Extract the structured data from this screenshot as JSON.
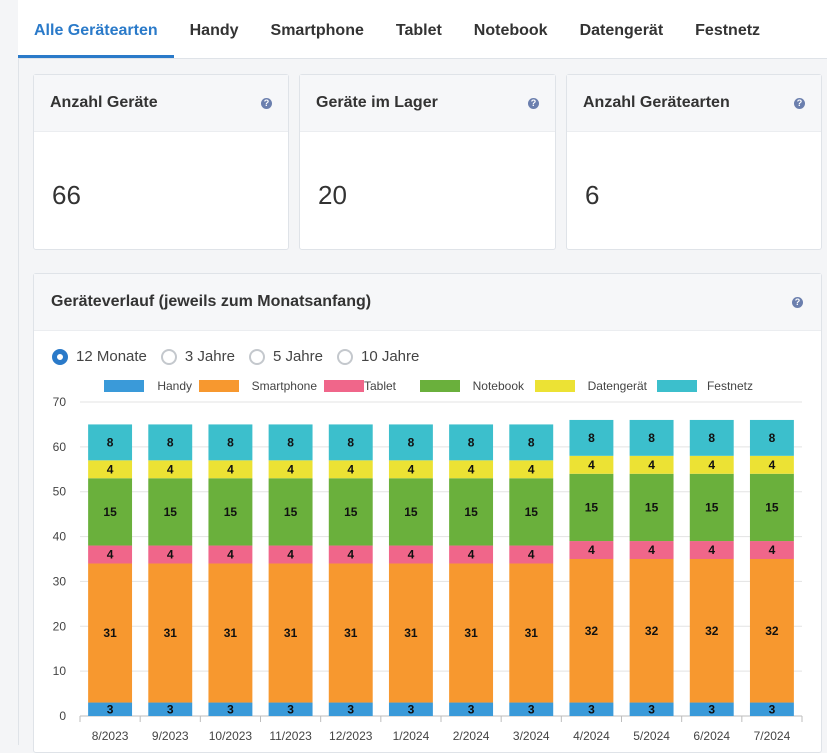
{
  "tabs": [
    "Alle Gerätearten",
    "Handy",
    "Smartphone",
    "Tablet",
    "Notebook",
    "Datengerät",
    "Festnetz"
  ],
  "cards": [
    {
      "title": "Anzahl Geräte",
      "value": "66"
    },
    {
      "title": "Geräte im Lager",
      "value": "20"
    },
    {
      "title": "Anzahl Gerätearten",
      "value": "6"
    }
  ],
  "help_glyph": "?",
  "panel_title": "Geräteverlauf (jeweils zum Monatsanfang)",
  "ranges": [
    "12 Monate",
    "3 Jahre",
    "5 Jahre",
    "10 Jahre"
  ],
  "selected_range": "12 Monate",
  "colors": {
    "accent": "#2a7ac9",
    "Handy": "#3a9ad9",
    "Smartphone": "#f7982f",
    "Tablet": "#f0668a",
    "Notebook": "#6ab03c",
    "Datengerät": "#ece234",
    "Festnetz": "#3cbfcc"
  },
  "chart_data": {
    "type": "bar",
    "stacked": true,
    "categories": [
      "8/2023",
      "9/2023",
      "10/2023",
      "11/2023",
      "12/2023",
      "1/2024",
      "2/2024",
      "3/2024",
      "4/2024",
      "5/2024",
      "6/2024",
      "7/2024"
    ],
    "series": [
      {
        "name": "Handy",
        "values": [
          3,
          3,
          3,
          3,
          3,
          3,
          3,
          3,
          3,
          3,
          3,
          3
        ]
      },
      {
        "name": "Smartphone",
        "values": [
          31,
          31,
          31,
          31,
          31,
          31,
          31,
          31,
          32,
          32,
          32,
          32
        ]
      },
      {
        "name": "Tablet",
        "values": [
          4,
          4,
          4,
          4,
          4,
          4,
          4,
          4,
          4,
          4,
          4,
          4
        ]
      },
      {
        "name": "Notebook",
        "values": [
          15,
          15,
          15,
          15,
          15,
          15,
          15,
          15,
          15,
          15,
          15,
          15
        ]
      },
      {
        "name": "Datengerät",
        "values": [
          4,
          4,
          4,
          4,
          4,
          4,
          4,
          4,
          4,
          4,
          4,
          4
        ]
      },
      {
        "name": "Festnetz",
        "values": [
          8,
          8,
          8,
          8,
          8,
          8,
          8,
          8,
          8,
          8,
          8,
          8
        ]
      }
    ],
    "ylim": [
      0,
      70
    ],
    "yticks": [
      0,
      10,
      20,
      30,
      40,
      50,
      60,
      70
    ],
    "grid": true,
    "legend": "top"
  }
}
